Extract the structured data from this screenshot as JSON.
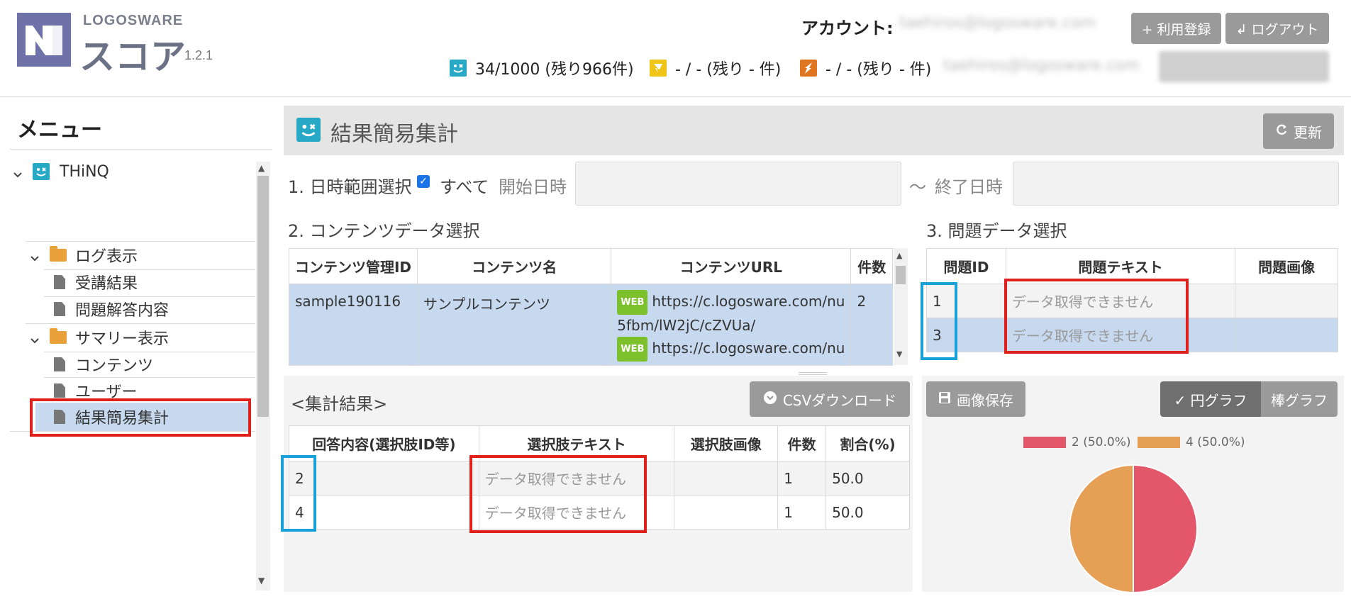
{
  "header": {
    "brand": "LOGOSWARE",
    "product": "スコア",
    "version": "1.2.1",
    "account_label": "アカウント:",
    "account_email": "taehiros@logosware.com",
    "register_label": "+ 利用登録",
    "logout_label": "↲ ログアウト",
    "quota_email": "taehiros@logosware.com",
    "quota_button_label": "",
    "quotas": [
      {
        "icon": "thinq-icon",
        "color": "#27a9c5",
        "text": "34/1000 (残り966件)"
      },
      {
        "icon": "yellow-shield-icon",
        "color": "#f0c419",
        "text": "- / - (残り - 件)"
      },
      {
        "icon": "orange-flash-icon",
        "color": "#e0761f",
        "text": "- / - (残り - 件)"
      }
    ]
  },
  "sidebar": {
    "title": "メニュー",
    "root": "THiNQ",
    "groups": [
      {
        "label": "ログ表示",
        "items": [
          "受講結果",
          "問題解答内容"
        ]
      },
      {
        "label": "サマリー表示",
        "items": [
          "コンテンツ",
          "ユーザー",
          "結果簡易集計"
        ]
      }
    ],
    "selected": "結果簡易集計"
  },
  "main": {
    "title": "結果簡易集計",
    "refresh_label": "更新",
    "step1_label": "1. 日時範囲選択",
    "all_label": "すべて",
    "start_label": "開始日時",
    "tilde": "～",
    "end_label": "終了日時",
    "step2_label": "2. コンテンツデータ選択",
    "step3_label": "3. 問題データ選択",
    "content_table": {
      "headers": [
        "コンテンツ管理ID",
        "コンテンツ名",
        "コンテンツURL",
        "件数"
      ],
      "row": {
        "id": "sample190116",
        "name": "サンプルコンテンツ",
        "badge": "WEB",
        "url1_line1": "https://c.logosware.com/nu",
        "url1_line2": "5fbm/lW2jC/cZVUa/",
        "url2_line1": "https://c.logosware.com/nu",
        "count": "2"
      }
    },
    "question_table": {
      "headers": [
        "問題ID",
        "問題テキスト",
        "問題画像"
      ],
      "rows": [
        {
          "id": "1",
          "text": "データ取得できません",
          "image": ""
        },
        {
          "id": "3",
          "text": "データ取得できません",
          "image": ""
        }
      ]
    },
    "results_label": "<集計結果>",
    "csv_label": "CSVダウンロード",
    "save_image_label": "画像保存",
    "pie_label": "✓ 円グラフ",
    "bar_label": "棒グラフ",
    "results_table": {
      "headers": [
        "回答内容(選択肢ID等)",
        "選択肢テキスト",
        "選択肢画像",
        "件数",
        "割合(%)"
      ],
      "rows": [
        {
          "answer": "2",
          "text": "データ取得できません",
          "image": "",
          "count": "1",
          "ratio": "50.0"
        },
        {
          "answer": "4",
          "text": "データ取得できません",
          "image": "",
          "count": "1",
          "ratio": "50.0"
        }
      ]
    }
  },
  "chart_data": {
    "type": "pie",
    "categories": [
      "2",
      "4"
    ],
    "values": [
      50.0,
      50.0
    ],
    "legend": [
      "2 (50.0%)",
      "4 (50.0%)"
    ],
    "colors": [
      "#e4566a",
      "#e6a055"
    ],
    "legend_position": "top"
  }
}
